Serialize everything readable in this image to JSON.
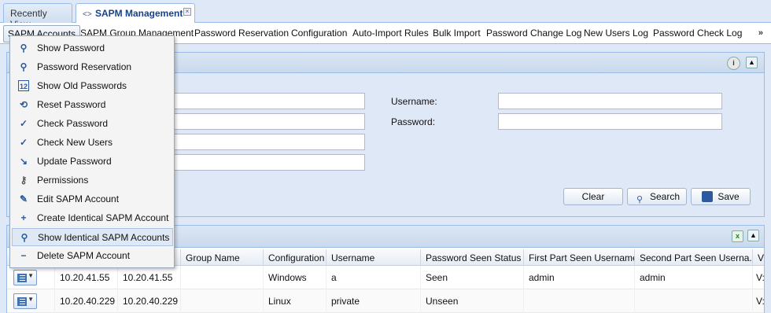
{
  "tabs": [
    {
      "label": "Recently View"
    },
    {
      "label": "SAPM Management"
    }
  ],
  "menubar": [
    "SAPM Accounts",
    "SAPM Group Management",
    "Password Reservation",
    "Configuration",
    "Auto-Import Rules",
    "Bulk Import",
    "Password Change Log",
    "New Users Log",
    "Password Check Log"
  ],
  "menubar_more": "»",
  "dropdown": [
    {
      "label": "Show Password",
      "icon": "magnifier-icon"
    },
    {
      "label": "Password Reservation",
      "icon": "magnifier-icon"
    },
    {
      "label": "Show Old Passwords",
      "icon": "calendar-icon"
    },
    {
      "label": "Reset Password",
      "icon": "reset-icon"
    },
    {
      "label": "Check Password",
      "icon": "check-icon"
    },
    {
      "label": "Check New Users",
      "icon": "check-icon"
    },
    {
      "label": "Update Password",
      "icon": "arrow-down-right-icon"
    },
    {
      "label": "Permissions",
      "icon": "user-key-icon"
    },
    {
      "label": "Edit SAPM Account",
      "icon": "pencil-icon"
    },
    {
      "label": "Create Identical SAPM Account",
      "icon": "plus-icon"
    },
    {
      "label": "Show Identical SAPM Accounts",
      "icon": "magnifier-icon"
    },
    {
      "label": "Delete SAPM Account",
      "icon": "minus-icon"
    }
  ],
  "filter": {
    "username_label": "Username:",
    "password_label": "Password:",
    "username_value": "",
    "password_value": "",
    "clear_label": "Clear",
    "search_label": "Search",
    "save_label": "Save"
  },
  "grid": {
    "columns": [
      "Group Name",
      "Configuration",
      "Username",
      "Password Seen Status",
      "First Part Seen Username",
      "Second Part Seen Userna...",
      "V"
    ],
    "rows": [
      {
        "c1": "10.20.41.55",
        "c2": "10.20.41.55",
        "group": "",
        "config": "Windows",
        "username": "a",
        "seen": "Seen",
        "first": "admin",
        "second": "admin",
        "v": "V:"
      },
      {
        "c1": "10.20.40.229",
        "c2": "10.20.40.229",
        "group": "",
        "config": "Linux",
        "username": "private",
        "seen": "Unseen",
        "first": "",
        "second": "",
        "v": "V:"
      }
    ]
  }
}
